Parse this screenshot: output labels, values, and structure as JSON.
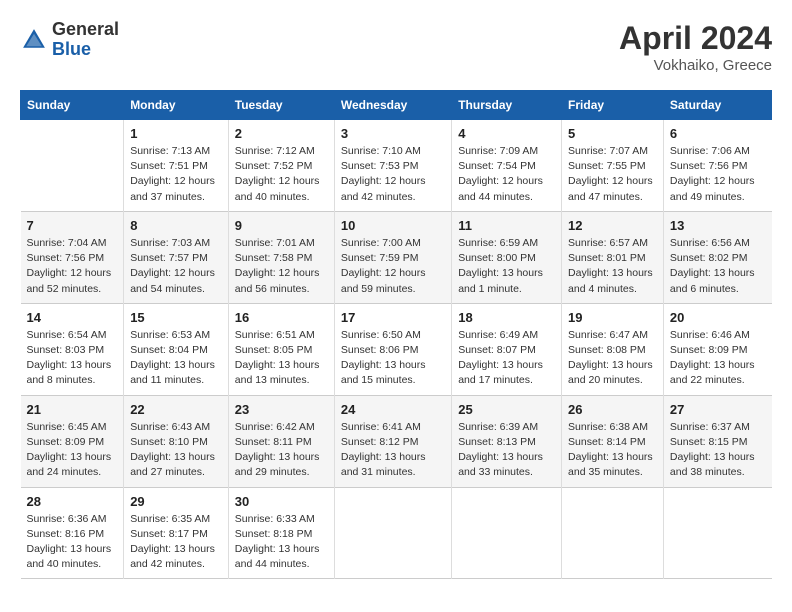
{
  "logo": {
    "general": "General",
    "blue": "Blue"
  },
  "title": "April 2024",
  "location": "Vokhaiko, Greece",
  "days_header": [
    "Sunday",
    "Monday",
    "Tuesday",
    "Wednesday",
    "Thursday",
    "Friday",
    "Saturday"
  ],
  "weeks": [
    [
      {
        "day": "",
        "sunrise": "",
        "sunset": "",
        "daylight": ""
      },
      {
        "day": "1",
        "sunrise": "Sunrise: 7:13 AM",
        "sunset": "Sunset: 7:51 PM",
        "daylight": "Daylight: 12 hours and 37 minutes."
      },
      {
        "day": "2",
        "sunrise": "Sunrise: 7:12 AM",
        "sunset": "Sunset: 7:52 PM",
        "daylight": "Daylight: 12 hours and 40 minutes."
      },
      {
        "day": "3",
        "sunrise": "Sunrise: 7:10 AM",
        "sunset": "Sunset: 7:53 PM",
        "daylight": "Daylight: 12 hours and 42 minutes."
      },
      {
        "day": "4",
        "sunrise": "Sunrise: 7:09 AM",
        "sunset": "Sunset: 7:54 PM",
        "daylight": "Daylight: 12 hours and 44 minutes."
      },
      {
        "day": "5",
        "sunrise": "Sunrise: 7:07 AM",
        "sunset": "Sunset: 7:55 PM",
        "daylight": "Daylight: 12 hours and 47 minutes."
      },
      {
        "day": "6",
        "sunrise": "Sunrise: 7:06 AM",
        "sunset": "Sunset: 7:56 PM",
        "daylight": "Daylight: 12 hours and 49 minutes."
      }
    ],
    [
      {
        "day": "7",
        "sunrise": "Sunrise: 7:04 AM",
        "sunset": "Sunset: 7:56 PM",
        "daylight": "Daylight: 12 hours and 52 minutes."
      },
      {
        "day": "8",
        "sunrise": "Sunrise: 7:03 AM",
        "sunset": "Sunset: 7:57 PM",
        "daylight": "Daylight: 12 hours and 54 minutes."
      },
      {
        "day": "9",
        "sunrise": "Sunrise: 7:01 AM",
        "sunset": "Sunset: 7:58 PM",
        "daylight": "Daylight: 12 hours and 56 minutes."
      },
      {
        "day": "10",
        "sunrise": "Sunrise: 7:00 AM",
        "sunset": "Sunset: 7:59 PM",
        "daylight": "Daylight: 12 hours and 59 minutes."
      },
      {
        "day": "11",
        "sunrise": "Sunrise: 6:59 AM",
        "sunset": "Sunset: 8:00 PM",
        "daylight": "Daylight: 13 hours and 1 minute."
      },
      {
        "day": "12",
        "sunrise": "Sunrise: 6:57 AM",
        "sunset": "Sunset: 8:01 PM",
        "daylight": "Daylight: 13 hours and 4 minutes."
      },
      {
        "day": "13",
        "sunrise": "Sunrise: 6:56 AM",
        "sunset": "Sunset: 8:02 PM",
        "daylight": "Daylight: 13 hours and 6 minutes."
      }
    ],
    [
      {
        "day": "14",
        "sunrise": "Sunrise: 6:54 AM",
        "sunset": "Sunset: 8:03 PM",
        "daylight": "Daylight: 13 hours and 8 minutes."
      },
      {
        "day": "15",
        "sunrise": "Sunrise: 6:53 AM",
        "sunset": "Sunset: 8:04 PM",
        "daylight": "Daylight: 13 hours and 11 minutes."
      },
      {
        "day": "16",
        "sunrise": "Sunrise: 6:51 AM",
        "sunset": "Sunset: 8:05 PM",
        "daylight": "Daylight: 13 hours and 13 minutes."
      },
      {
        "day": "17",
        "sunrise": "Sunrise: 6:50 AM",
        "sunset": "Sunset: 8:06 PM",
        "daylight": "Daylight: 13 hours and 15 minutes."
      },
      {
        "day": "18",
        "sunrise": "Sunrise: 6:49 AM",
        "sunset": "Sunset: 8:07 PM",
        "daylight": "Daylight: 13 hours and 17 minutes."
      },
      {
        "day": "19",
        "sunrise": "Sunrise: 6:47 AM",
        "sunset": "Sunset: 8:08 PM",
        "daylight": "Daylight: 13 hours and 20 minutes."
      },
      {
        "day": "20",
        "sunrise": "Sunrise: 6:46 AM",
        "sunset": "Sunset: 8:09 PM",
        "daylight": "Daylight: 13 hours and 22 minutes."
      }
    ],
    [
      {
        "day": "21",
        "sunrise": "Sunrise: 6:45 AM",
        "sunset": "Sunset: 8:09 PM",
        "daylight": "Daylight: 13 hours and 24 minutes."
      },
      {
        "day": "22",
        "sunrise": "Sunrise: 6:43 AM",
        "sunset": "Sunset: 8:10 PM",
        "daylight": "Daylight: 13 hours and 27 minutes."
      },
      {
        "day": "23",
        "sunrise": "Sunrise: 6:42 AM",
        "sunset": "Sunset: 8:11 PM",
        "daylight": "Daylight: 13 hours and 29 minutes."
      },
      {
        "day": "24",
        "sunrise": "Sunrise: 6:41 AM",
        "sunset": "Sunset: 8:12 PM",
        "daylight": "Daylight: 13 hours and 31 minutes."
      },
      {
        "day": "25",
        "sunrise": "Sunrise: 6:39 AM",
        "sunset": "Sunset: 8:13 PM",
        "daylight": "Daylight: 13 hours and 33 minutes."
      },
      {
        "day": "26",
        "sunrise": "Sunrise: 6:38 AM",
        "sunset": "Sunset: 8:14 PM",
        "daylight": "Daylight: 13 hours and 35 minutes."
      },
      {
        "day": "27",
        "sunrise": "Sunrise: 6:37 AM",
        "sunset": "Sunset: 8:15 PM",
        "daylight": "Daylight: 13 hours and 38 minutes."
      }
    ],
    [
      {
        "day": "28",
        "sunrise": "Sunrise: 6:36 AM",
        "sunset": "Sunset: 8:16 PM",
        "daylight": "Daylight: 13 hours and 40 minutes."
      },
      {
        "day": "29",
        "sunrise": "Sunrise: 6:35 AM",
        "sunset": "Sunset: 8:17 PM",
        "daylight": "Daylight: 13 hours and 42 minutes."
      },
      {
        "day": "30",
        "sunrise": "Sunrise: 6:33 AM",
        "sunset": "Sunset: 8:18 PM",
        "daylight": "Daylight: 13 hours and 44 minutes."
      },
      {
        "day": "",
        "sunrise": "",
        "sunset": "",
        "daylight": ""
      },
      {
        "day": "",
        "sunrise": "",
        "sunset": "",
        "daylight": ""
      },
      {
        "day": "",
        "sunrise": "",
        "sunset": "",
        "daylight": ""
      },
      {
        "day": "",
        "sunrise": "",
        "sunset": "",
        "daylight": ""
      }
    ]
  ]
}
